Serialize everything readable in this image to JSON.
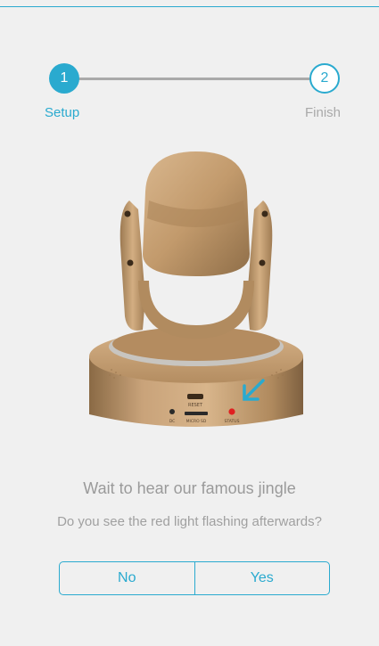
{
  "stepper": {
    "steps": [
      {
        "number": "1",
        "label": "Setup",
        "state": "active"
      },
      {
        "number": "2",
        "label": "Finish",
        "state": "inactive"
      }
    ]
  },
  "illustration": {
    "subject": "camera-device",
    "led_color": "#e02020",
    "arrow_color": "#2aaacf"
  },
  "content": {
    "headline": "Wait to hear our famous jingle",
    "question": "Do you see the red light flashing afterwards?"
  },
  "buttons": {
    "no": "No",
    "yes": "Yes"
  },
  "colors": {
    "accent": "#2aaacf",
    "inactive": "#a9a9a9",
    "background": "#f0f0f0"
  }
}
